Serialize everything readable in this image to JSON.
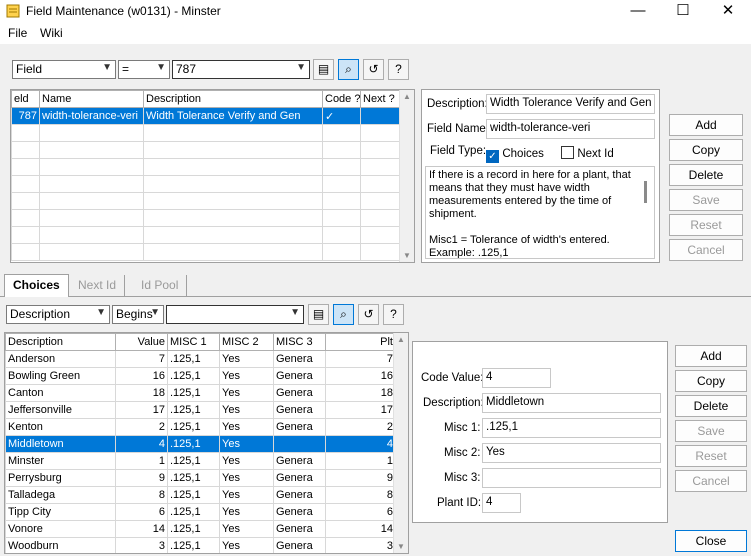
{
  "window": {
    "title": "Field Maintenance (w0131) - Minster",
    "min": "—",
    "max": "☐",
    "close": "✕"
  },
  "menu": {
    "file": "File",
    "wiki": "Wiki"
  },
  "top_filter": {
    "field": "Field",
    "op": "=",
    "value": "787"
  },
  "top_grid": {
    "headers": [
      "eld",
      "Name",
      "Description",
      "Code ?",
      "Next ?"
    ],
    "row": {
      "id": "787",
      "name": "width-tolerance-veri",
      "desc": "Width Tolerance Verify and Gen",
      "code": "✓",
      "next": ""
    }
  },
  "detail": {
    "desc_label": "Description:",
    "desc_value": "Width Tolerance Verify and Gen",
    "name_label": "Field Name:",
    "name_value": "width-tolerance-veri",
    "type_label": "Field Type:",
    "choices_label": "Choices",
    "nextid_label": "Next Id",
    "notes_line1": "If there is a record in here for a plant, that",
    "notes_line2": "means that they must have width",
    "notes_line3": "measurements entered by the time of",
    "notes_line4": "shipment.",
    "notes_line5": "Misc1 = Tolerance of width's entered.",
    "notes_line6": "Example: .125,1"
  },
  "top_buttons": {
    "add": "Add",
    "copy": "Copy",
    "delete": "Delete",
    "save": "Save",
    "reset": "Reset",
    "cancel": "Cancel"
  },
  "tabs": {
    "choices": "Choices",
    "next_id": "Next Id",
    "id_pool": "Id Pool"
  },
  "bottom_filter": {
    "field": "Description",
    "op": "Begins",
    "value": ""
  },
  "choices_grid": {
    "headers": [
      "Description",
      "Value",
      "MISC 1",
      "MISC 2",
      "MISC 3",
      "Plt"
    ],
    "rows": [
      [
        "Anderson",
        "7",
        ".125,1",
        "Yes",
        "Genera",
        "7"
      ],
      [
        "Bowling Green",
        "16",
        ".125,1",
        "Yes",
        "Genera",
        "16"
      ],
      [
        "Canton",
        "18",
        ".125,1",
        "Yes",
        "Genera",
        "18"
      ],
      [
        "Jeffersonville",
        "17",
        ".125,1",
        "Yes",
        "Genera",
        "17"
      ],
      [
        "Kenton",
        "2",
        ".125,1",
        "Yes",
        "Genera",
        "2"
      ],
      [
        "Middletown",
        "4",
        ".125,1",
        "Yes",
        "",
        "4"
      ],
      [
        "Minster",
        "1",
        ".125,1",
        "Yes",
        "Genera",
        "1"
      ],
      [
        "Perrysburg",
        "9",
        ".125,1",
        "Yes",
        "Genera",
        "9"
      ],
      [
        "Talladega",
        "8",
        ".125,1",
        "Yes",
        "Genera",
        "8"
      ],
      [
        "Tipp City",
        "6",
        ".125,1",
        "Yes",
        "Genera",
        "6"
      ],
      [
        "Vonore",
        "14",
        ".125,1",
        "Yes",
        "Genera",
        "14"
      ],
      [
        "Woodburn",
        "3",
        ".125,1",
        "Yes",
        "Genera",
        "3"
      ]
    ]
  },
  "choice_detail": {
    "code_label": "Code Value:",
    "code_value": "4",
    "desc_label": "Description:",
    "desc_value": "Middletown",
    "misc1_label": "Misc 1:",
    "misc1_value": ".125,1",
    "misc2_label": "Misc 2:",
    "misc2_value": "Yes",
    "misc3_label": "Misc 3:",
    "misc3_value": "",
    "plant_label": "Plant ID:",
    "plant_value": "4"
  },
  "bottom_buttons": {
    "add": "Add",
    "copy": "Copy",
    "delete": "Delete",
    "save": "Save",
    "reset": "Reset",
    "cancel": "Cancel",
    "close": "Close"
  }
}
